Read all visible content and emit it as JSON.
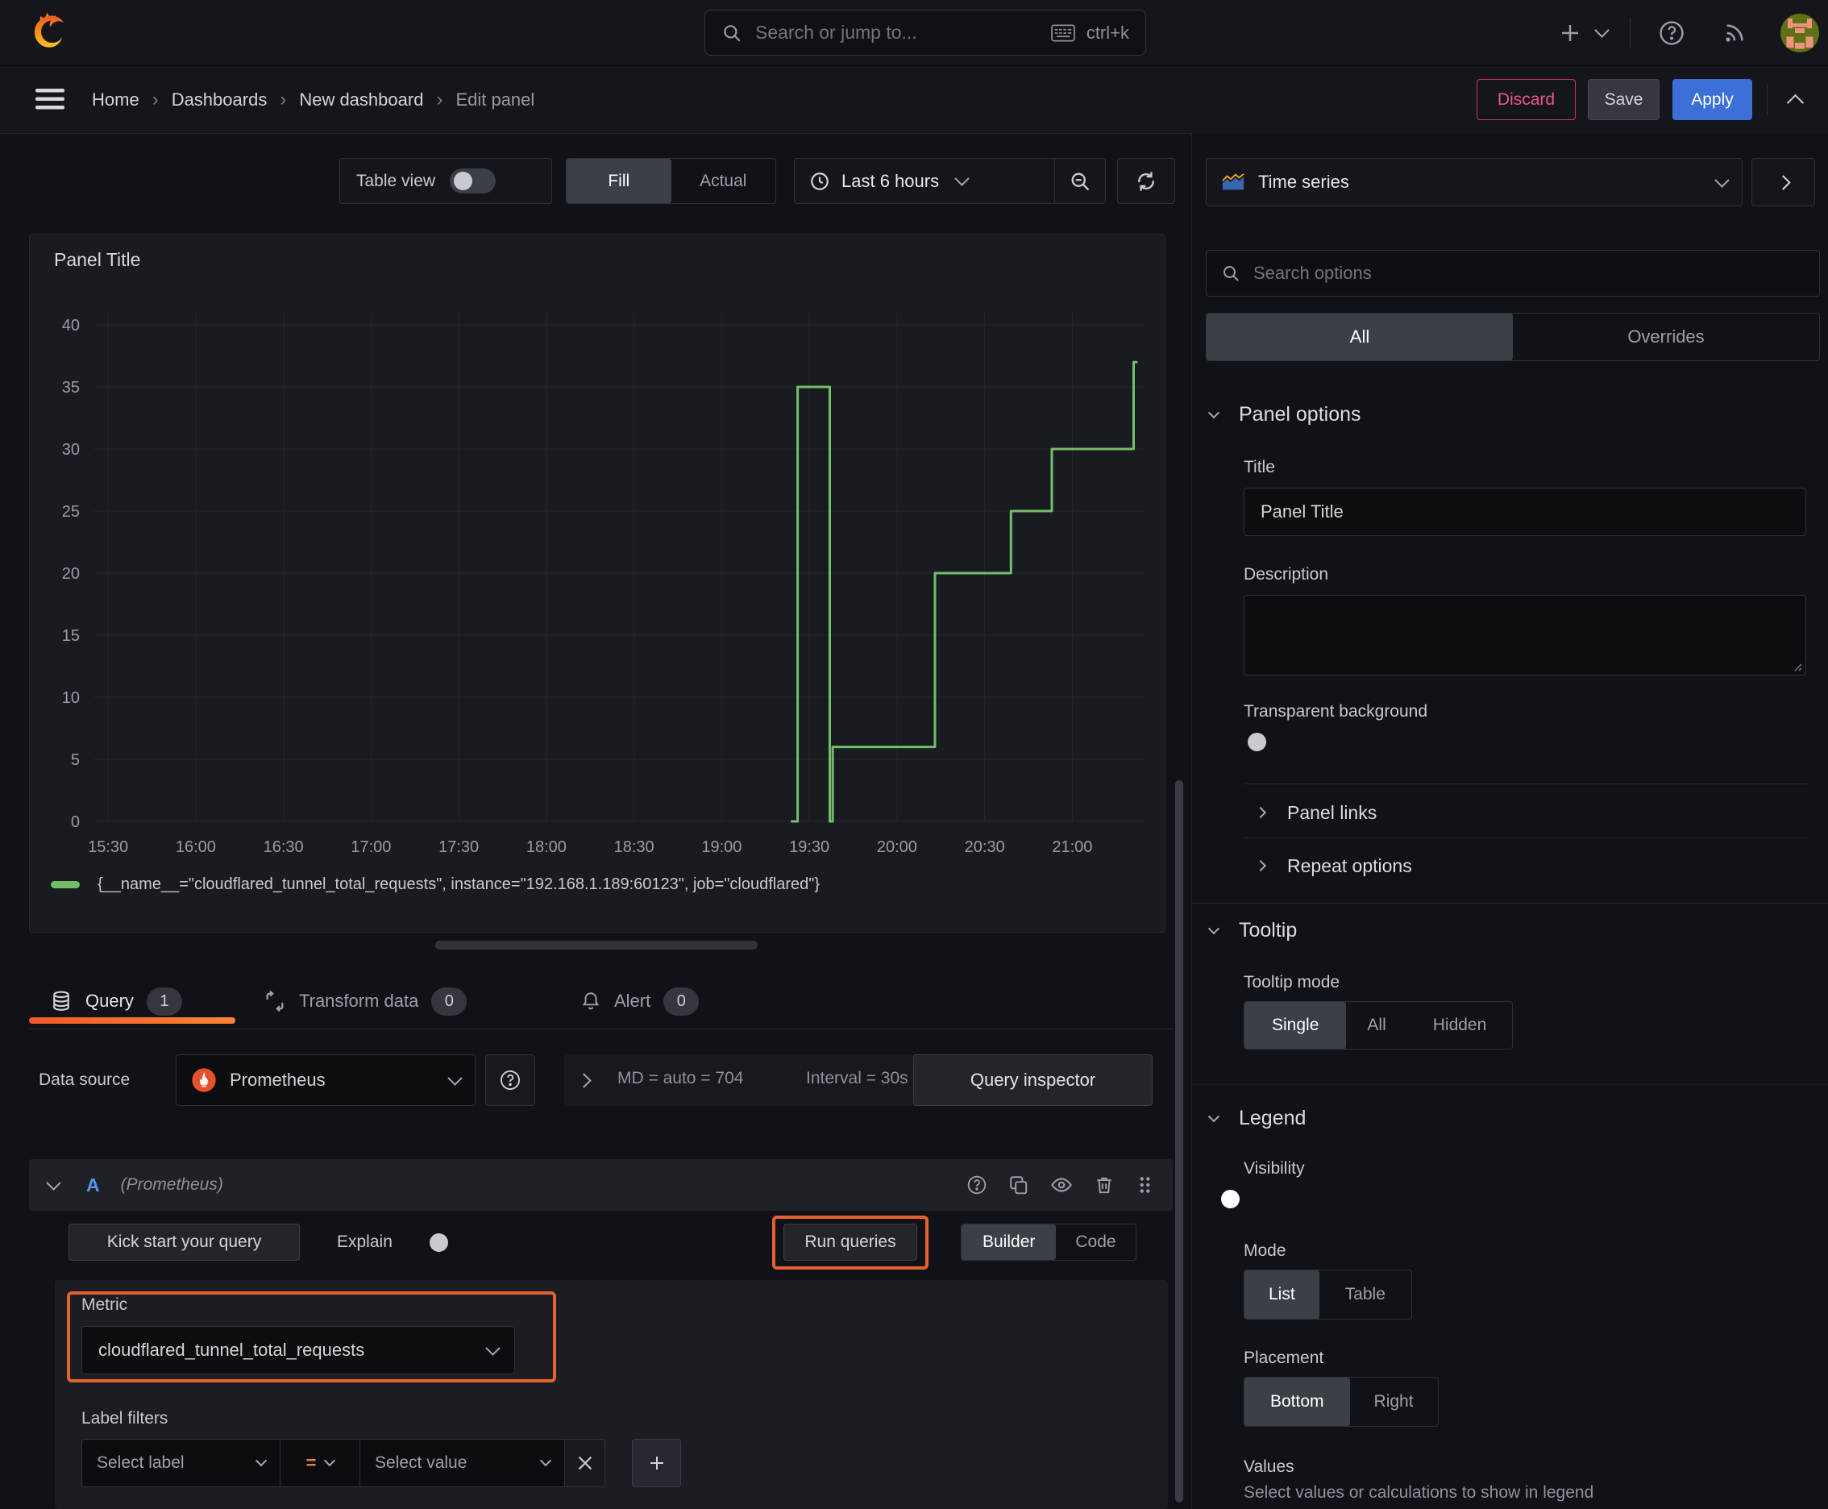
{
  "navbar": {
    "search_placeholder": "Search or jump to...",
    "shortcut": "ctrl+k"
  },
  "breadcrumb": {
    "items": [
      "Home",
      "Dashboards",
      "New dashboard",
      "Edit panel"
    ],
    "separator": "›"
  },
  "actions": {
    "discard": "Discard",
    "save": "Save",
    "apply": "Apply"
  },
  "toolbar": {
    "table_view": "Table view",
    "fill": "Fill",
    "actual": "Actual",
    "time_range": "Last 6 hours"
  },
  "panel": {
    "title": "Panel Title"
  },
  "chart_data": {
    "type": "line",
    "title": "Panel Title",
    "xlabel": "",
    "ylabel": "",
    "x_ticks": [
      "15:30",
      "16:00",
      "16:30",
      "17:00",
      "17:30",
      "18:00",
      "18:30",
      "19:00",
      "19:30",
      "20:00",
      "20:30",
      "21:00"
    ],
    "y_ticks": [
      0,
      5,
      10,
      15,
      20,
      25,
      30,
      35,
      40
    ],
    "ylim": [
      0,
      42
    ],
    "x_range": [
      "15:25",
      "21:25"
    ],
    "grid": true,
    "legend_position": "bottom",
    "series": [
      {
        "name": "{__name__=\"cloudflared_tunnel_total_requests\", instance=\"192.168.1.189:60123\", job=\"cloudflared\"}",
        "color": "#73BF69",
        "points": [
          [
            "19:24",
            0
          ],
          [
            "19:26",
            0
          ],
          [
            "19:26",
            35
          ],
          [
            "19:37",
            35
          ],
          [
            "19:37",
            0
          ],
          [
            "19:38",
            0
          ],
          [
            "19:38",
            6
          ],
          [
            "20:13",
            6
          ],
          [
            "20:13",
            20
          ],
          [
            "20:39",
            20
          ],
          [
            "20:39",
            25
          ],
          [
            "20:53",
            25
          ],
          [
            "20:53",
            30
          ],
          [
            "21:21",
            30
          ],
          [
            "21:21",
            37
          ],
          [
            "21:22",
            37
          ]
        ]
      }
    ]
  },
  "query": {
    "tabs": [
      {
        "label": "Query",
        "badge": "1"
      },
      {
        "label": "Transform data",
        "badge": "0"
      },
      {
        "label": "Alert",
        "badge": "0"
      }
    ],
    "datasource_label": "Data source",
    "datasource": "Prometheus",
    "md_stat": "MD = auto = 704",
    "interval_stat": "Interval = 30s",
    "query_inspector": "Query inspector",
    "ref_id": "A",
    "ref_hint": "(Prometheus)",
    "kick_start": "Kick start your query",
    "explain": "Explain",
    "run_queries": "Run queries",
    "builder": "Builder",
    "code": "Code",
    "metric_label": "Metric",
    "metric_value": "cloudflared_tunnel_total_requests",
    "label_filters": "Label filters",
    "select_label": "Select label",
    "operator": "=",
    "select_value": "Select value"
  },
  "sidebar": {
    "visualization": "Time series",
    "search_placeholder": "Search options",
    "tab_all": "All",
    "tab_overrides": "Overrides",
    "panel_options": {
      "heading": "Panel options",
      "title_label": "Title",
      "title_value": "Panel Title",
      "description_label": "Description",
      "transparent": "Transparent background"
    },
    "links": "Panel links",
    "repeat": "Repeat options",
    "tooltip": {
      "heading": "Tooltip",
      "mode_label": "Tooltip mode",
      "single": "Single",
      "all": "All",
      "hidden": "Hidden"
    },
    "legend": {
      "heading": "Legend",
      "visibility": "Visibility",
      "mode_label": "Mode",
      "list": "List",
      "table": "Table",
      "placement_label": "Placement",
      "bottom": "Bottom",
      "right": "Right",
      "values_label": "Values",
      "values_hint": "Select values or calculations to show in legend"
    }
  },
  "colors": {
    "accent_blue": "#3C6FD8",
    "accent_orange": "#E5622D",
    "series_green": "#73BF69",
    "tab_underline_from": "#F05A28",
    "tab_underline_to": "#FB8532",
    "discard_red": "#CF2F63"
  }
}
